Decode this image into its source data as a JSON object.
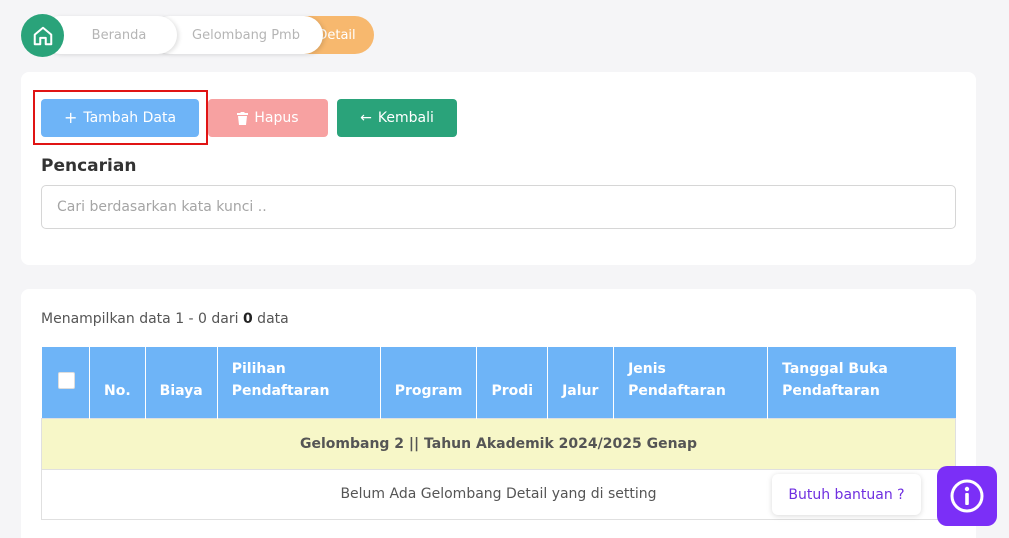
{
  "breadcrumb": {
    "items": [
      "Beranda",
      "Gelombang Pmb",
      "Detail"
    ]
  },
  "toolbar": {
    "add_label": "Tambah Data",
    "delete_label": "Hapus",
    "back_label": "Kembali"
  },
  "search": {
    "label": "Pencarian",
    "placeholder": "Cari berdasarkan kata kunci .."
  },
  "summary": {
    "prefix": "Menampilkan data 1 - 0 dari ",
    "total": "0",
    "suffix": " data"
  },
  "table": {
    "columns": [
      {
        "line1": "No.",
        "line2": ""
      },
      {
        "line1": "Biaya",
        "line2": ""
      },
      {
        "line1": "Pilihan",
        "line2": "Pendaftaran"
      },
      {
        "line1": "Program",
        "line2": ""
      },
      {
        "line1": "Prodi",
        "line2": ""
      },
      {
        "line1": "Jalur",
        "line2": ""
      },
      {
        "line1": "Jenis",
        "line2": "Pendaftaran"
      },
      {
        "line1": "Tanggal Buka",
        "line2": "Pendaftaran"
      }
    ],
    "group_title": "Gelombang 2 || Tahun Akademik 2024/2025 Genap",
    "empty_message": "Belum Ada Gelombang Detail yang di setting"
  },
  "help": {
    "label": "Butuh bantuan ?"
  },
  "colors": {
    "primary": "#6eb4f7",
    "danger": "#f7a1a1",
    "success": "#2aa37a",
    "warning": "#f7b86e",
    "help": "#7b2ff7"
  },
  "icons": {
    "home": "home-icon",
    "add": "plus-icon",
    "delete": "trash-icon",
    "back": "arrow-left-icon",
    "help": "info-icon"
  }
}
